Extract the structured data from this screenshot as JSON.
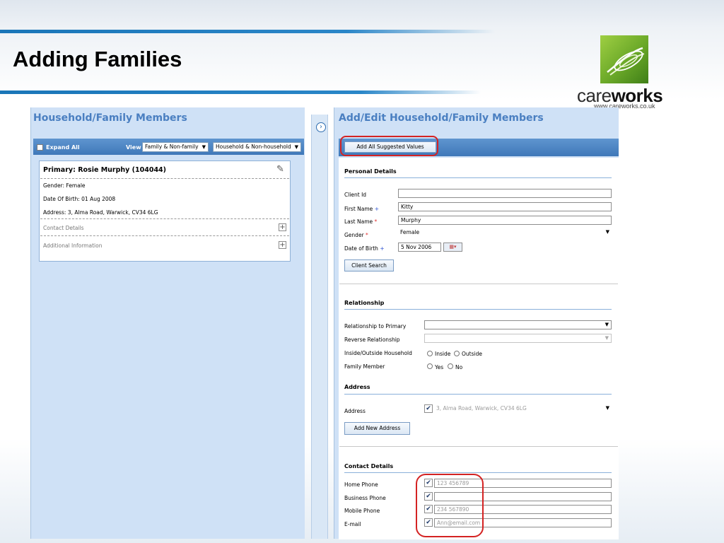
{
  "slide": {
    "title": "Adding Families",
    "logo_care": "care",
    "logo_works": "works",
    "logo_url": "www.careworks.co.uk"
  },
  "left_panel": {
    "heading": "Household/Family Members",
    "expand_all": "Expand All",
    "view_label": "View",
    "view_select": "Family & Non-family",
    "household_select": "Household & Non-household",
    "member": {
      "title": "Primary: Rosie Murphy (104044)",
      "gender": "Gender: Female",
      "dob": "Date Of Birth: 01 Aug 2008",
      "address": "Address: 3, Alma Road, Warwick, CV34 6LG",
      "contact_details": "Contact Details",
      "additional_information": "Additional Information"
    }
  },
  "splitter": {
    "icon": "chevron-right-icon"
  },
  "right_panel": {
    "heading": "Add/Edit Household/Family Members",
    "add_all_button": "Add All Suggested Values",
    "personal": {
      "title": "Personal Details",
      "client_id_label": "Client Id",
      "client_id_value": "",
      "first_name_label": "First Name",
      "first_name_value": "Kitty",
      "last_name_label": "Last Name",
      "last_name_value": "Murphy",
      "gender_label": "Gender",
      "gender_value": "Female",
      "dob_label": "Date of Birth",
      "dob_value": "5 Nov 2006",
      "required_mark": "*",
      "optional_mark": "+",
      "client_search_button": "Client Search"
    },
    "relationship": {
      "title": "Relationship",
      "to_primary_label": "Relationship to Primary",
      "to_primary_value": "",
      "reverse_label": "Reverse Relationship",
      "reverse_value": "",
      "inside_outside_label": "Inside/Outside Household",
      "inside": "Inside",
      "outside": "Outside",
      "family_member_label": "Family Member",
      "yes": "Yes",
      "no": "No"
    },
    "address": {
      "title": "Address",
      "address_label": "Address",
      "address_value": "3, Alma Road, Warwick, CV34 6LG",
      "add_new_button": "Add New Address"
    },
    "contact": {
      "title": "Contact Details",
      "home_phone_label": "Home Phone",
      "home_phone_value": "123 456789",
      "business_phone_label": "Business Phone",
      "business_phone_value": "",
      "mobile_phone_label": "Mobile Phone",
      "mobile_phone_value": "234 567890",
      "email_label": "E-mail",
      "email_value": "Ann@email.com"
    }
  },
  "colors": {
    "accent_blue": "#1a76b8",
    "panel_heading": "#4a7fc1",
    "highlight_red": "#d42323",
    "logo_green": "#6aa828"
  }
}
